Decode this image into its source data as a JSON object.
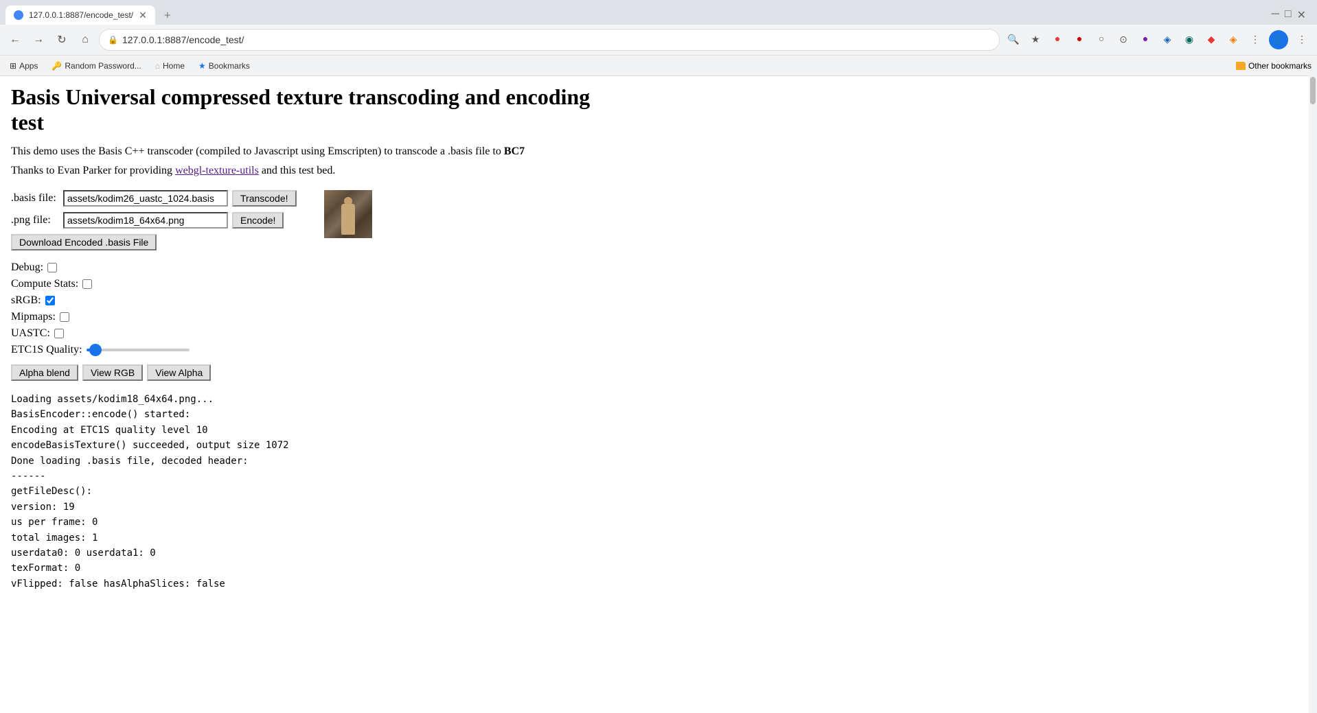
{
  "browser": {
    "tab": {
      "title": "127.0.0.1:8887/encode_test/",
      "favicon": "globe"
    },
    "address": "127.0.0.1:8887/encode_test/",
    "bookmarks": [
      {
        "id": "apps",
        "label": "Apps",
        "icon": "grid"
      },
      {
        "id": "random-password",
        "label": "Random Password...",
        "icon": "key"
      },
      {
        "id": "home",
        "label": "Home",
        "icon": "home"
      },
      {
        "id": "bookmarks",
        "label": "Bookmarks",
        "icon": "star"
      }
    ],
    "other_bookmarks_label": "Other bookmarks"
  },
  "page": {
    "title": "Basis Universal compressed texture transcoding and encoding test",
    "description_1": "This demo uses the Basis C++ transcoder (compiled to Javascript using Emscripten) to transcode a .basis file to",
    "description_bold": "BC7",
    "description_2": "Thanks to Evan Parker for providing",
    "description_link": "webgl-texture-utils",
    "description_3": "and this test bed."
  },
  "form": {
    "basis_label": ".basis file:",
    "basis_value": "assets/kodim26_uastc_1024.basis",
    "transcode_btn": "Transcode!",
    "png_label": ".png file:",
    "png_value": "assets/kodim18_64x64.png",
    "encode_btn": "Encode!",
    "download_btn": "Download Encoded .basis File",
    "debug_label": "Debug:",
    "debug_checked": false,
    "compute_stats_label": "Compute Stats:",
    "compute_stats_checked": false,
    "srgb_label": "sRGB:",
    "srgb_checked": true,
    "mipmaps_label": "Mipmaps:",
    "mipmaps_checked": false,
    "uastc_label": "UASTC:",
    "uastc_checked": false,
    "etc1s_quality_label": "ETC1S Quality:",
    "etc1s_quality_value": 10,
    "alpha_blend_btn": "Alpha blend",
    "view_rgb_btn": "View RGB",
    "view_alpha_btn": "View Alpha"
  },
  "log": {
    "lines": [
      "Loading assets/kodim18_64x64.png...",
      "BasisEncoder::encode() started:",
      "Encoding at ETC1S quality level 10",
      "encodeBasisTexture() succeeded, output size 1072",
      "Done loading .basis file, decoded header:",
      "------",
      "getFileDesc():",
      "version: 19",
      "us per frame: 0",
      "total images: 1",
      "userdata0: 0 userdata1: 0",
      "texFormat: 0",
      "vFlipped: false hasAlphaSlices: false"
    ]
  }
}
